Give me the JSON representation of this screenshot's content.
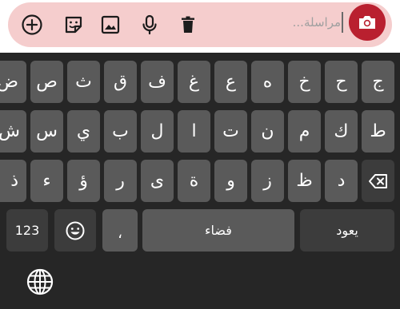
{
  "composer": {
    "placeholder": "مراسلة...",
    "icons": [
      "add-circle-icon",
      "sticker-icon",
      "image-icon",
      "mic-icon",
      "trash-icon",
      "camera-icon"
    ],
    "accent_color": "#b9202f",
    "pill_color": "#f5cdcd"
  },
  "keyboard": {
    "row1": [
      "ج",
      "ح",
      "خ",
      "ه",
      "ع",
      "غ",
      "ف",
      "ق",
      "ث",
      "ص",
      "ض"
    ],
    "row2": [
      "ط",
      "ك",
      "م",
      "ن",
      "ت",
      "ا",
      "ل",
      "ب",
      "ي",
      "س",
      "ش"
    ],
    "row3": [
      "د",
      "ظ",
      "ز",
      "و",
      "ة",
      "ى",
      "ر",
      "ؤ",
      "ء",
      "ذ"
    ],
    "numbers_label": "123",
    "comma_label": "،",
    "space_label": "فضاء",
    "enter_label": "يعود",
    "icons": [
      "backspace-icon",
      "emoji-icon",
      "globe-icon"
    ],
    "key_color": "#5a5a5a",
    "function_key_color": "#3c3c3c",
    "background_color": "#262626"
  }
}
